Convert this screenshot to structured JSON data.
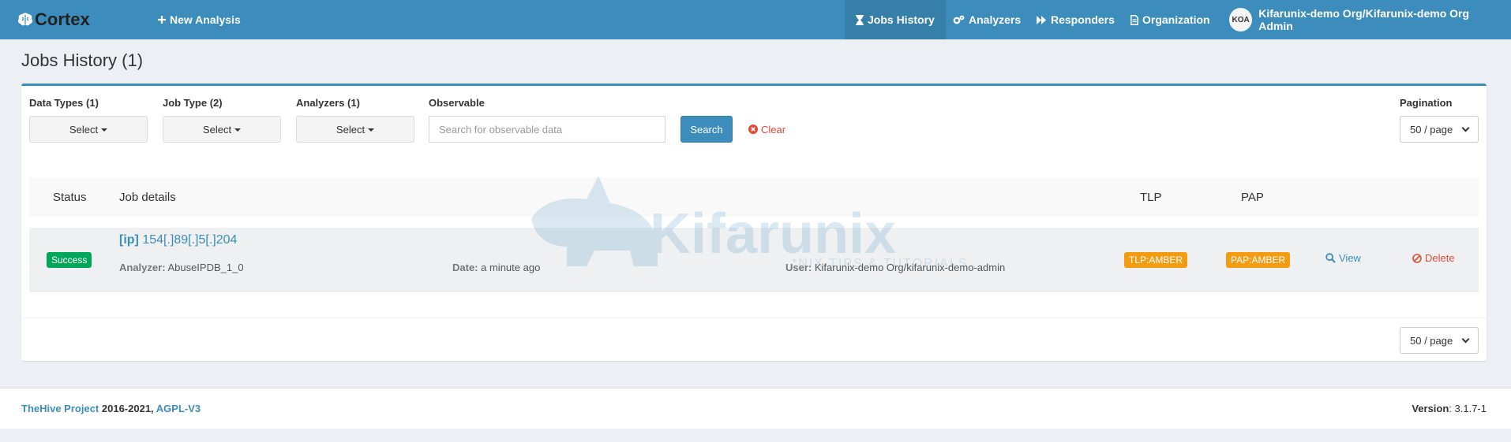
{
  "navbar": {
    "brand": "Cortex",
    "new_analysis": "New Analysis",
    "jobs_history": "Jobs History",
    "analyzers": "Analyzers",
    "responders": "Responders",
    "organization": "Organization",
    "user_initials": "KOA",
    "user_name": "Kifarunix-demo Org/Kifarunix-demo Org Admin"
  },
  "page": {
    "title": "Jobs History (1)"
  },
  "filters": {
    "data_types_label": "Data Types (1)",
    "job_type_label": "Job Type (2)",
    "analyzers_label": "Analyzers (1)",
    "observable_label": "Observable",
    "select_text": "Select",
    "observable_placeholder": "Search for observable data",
    "search_button": "Search",
    "clear_button": "Clear",
    "pagination_label": "Pagination",
    "pagination_value": "50 / page"
  },
  "table": {
    "headers": {
      "status": "Status",
      "job_details": "Job details",
      "tlp": "TLP",
      "pap": "PAP"
    },
    "rows": [
      {
        "status": "Success",
        "type": "[ip]",
        "observable": "154[.]89[.]5[.]204",
        "analyzer_label": "Analyzer:",
        "analyzer": "AbuseIPDB_1_0",
        "date_label": "Date:",
        "date": "a minute ago",
        "user_label": "User:",
        "user": "Kifarunix-demo Org/kifarunix-demo-admin",
        "tlp": "TLP:AMBER",
        "pap": "PAP:AMBER",
        "view": "View",
        "delete": "Delete"
      }
    ]
  },
  "bottom_pagination": "50 / page",
  "watermark": {
    "text": "Kifarunix",
    "subtitle": "*NIX TIPS & TUTORIALS"
  },
  "footer": {
    "project_link": "TheHive Project",
    "years": " 2016-2021, ",
    "license_link": "AGPL-V3",
    "version_label": "Version",
    "version": ": 3.1.7-1"
  },
  "colors": {
    "navbar": "#3c8dbc",
    "navbar_active": "#367fa9",
    "success": "#00a65a",
    "amber": "#f39c12",
    "danger": "#dd4b39",
    "background": "#ecf0f5"
  }
}
